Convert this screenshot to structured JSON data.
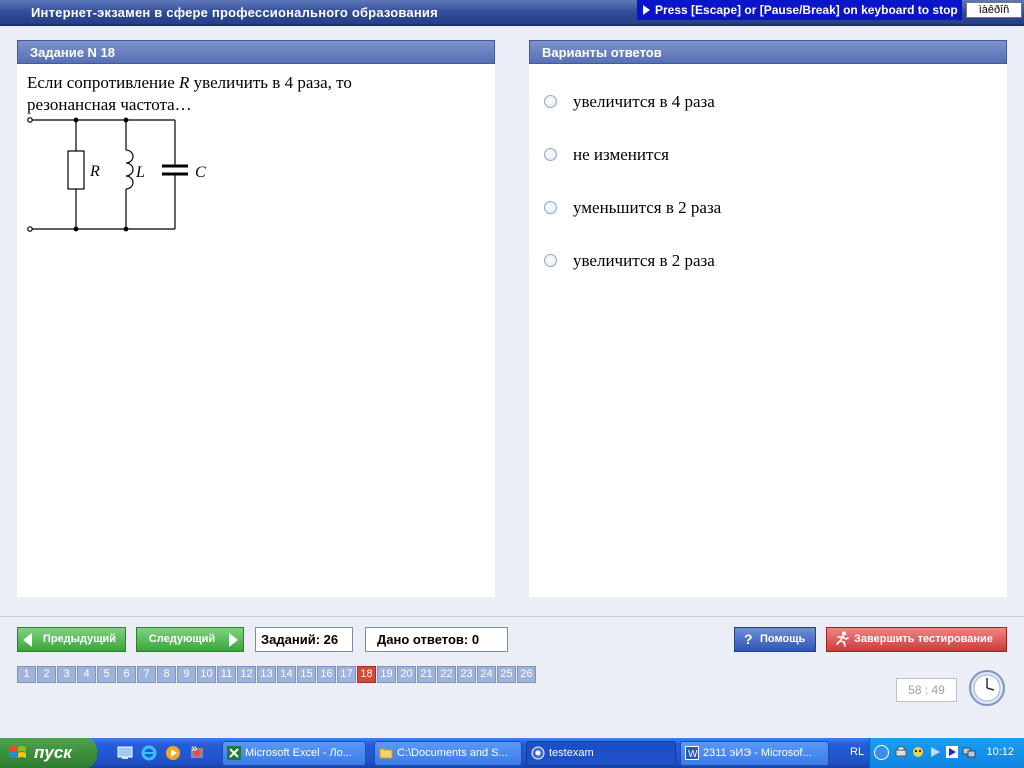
{
  "app": {
    "title": "Интернет-экзамен в сфере профессионального образования",
    "escape_hint": "Press [Escape] or [Pause/Break] on keyboard to stop",
    "lang_box": "ìàêðîñ"
  },
  "task": {
    "header": "Задание N 18",
    "question_prefix": "Если сопротивление ",
    "question_symbol": "R",
    "question_suffix": " увеличить в 4 раза, то резонансная частота…",
    "circuit": {
      "labels": [
        "R",
        "L",
        "C"
      ]
    }
  },
  "answers": {
    "header": "Варианты ответов",
    "options": [
      {
        "label": "увеличится в 4 раза",
        "selected": false
      },
      {
        "label": "не изменится",
        "selected": false
      },
      {
        "label": "уменьшится в 2 раза",
        "selected": false
      },
      {
        "label": "увеличится в 2 раза",
        "selected": false
      }
    ]
  },
  "nav": {
    "prev_label": "Предыдущий",
    "next_label": "Следующий",
    "tasks_count": "Заданий: 26",
    "answers_given": "Дано ответов: 0",
    "help_label": "Помощь",
    "finish_label": "Завершить тестирование"
  },
  "questions": {
    "numbers": [
      "1",
      "2",
      "3",
      "4",
      "5",
      "6",
      "7",
      "8",
      "9",
      "10",
      "11",
      "12",
      "13",
      "14",
      "15",
      "16",
      "17",
      "18",
      "19",
      "20",
      "21",
      "22",
      "23",
      "24",
      "25",
      "26"
    ],
    "current": "18"
  },
  "timer": "58 : 49",
  "taskbar": {
    "start_label": "пуск",
    "quick_launch": [
      "desktop-icon",
      "ie-icon",
      "media-player-icon",
      "firewall-icon"
    ],
    "more_label": "»",
    "items": [
      {
        "label": "Microsoft Excel - Ло...",
        "icon": "excel-icon",
        "active": false
      },
      {
        "label": "C:\\Documents and S...",
        "icon": "folder-icon",
        "active": false
      },
      {
        "label": "testexam",
        "icon": "testexam-icon",
        "active": true
      },
      {
        "label": "2311 эИЭ - Microsof...",
        "icon": "word-icon",
        "active": false
      }
    ],
    "lang": "RL",
    "clock": "10:12"
  },
  "colors": {
    "header_bg": "#5770b6",
    "nav_green": "#3aa53a",
    "help_blue": "#2e56b5",
    "finish_red": "#cc3b3b",
    "current_question": "#d64a3c",
    "question_tile": "#9fb4dc"
  }
}
